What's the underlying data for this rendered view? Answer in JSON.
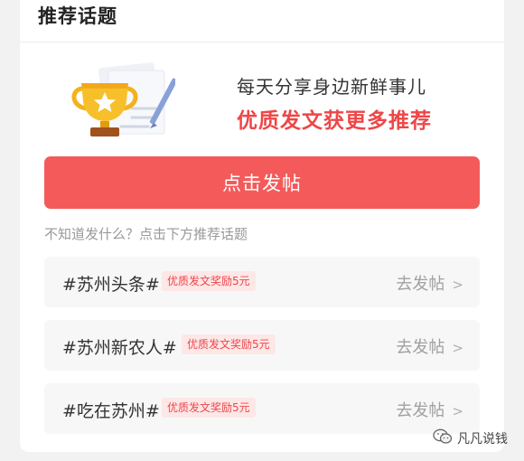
{
  "header": {
    "title": "推荐话题"
  },
  "promo": {
    "line1": "每天分享身边新鲜事儿",
    "line2": "优质发文获更多推荐",
    "illustration_icon": "trophy-with-document-and-pen"
  },
  "post_button": {
    "label": "点击发帖"
  },
  "hint": "不知道发什么？点击下方推荐话题",
  "topics": [
    {
      "name": "#苏州头条#",
      "badge": "优质发文奖励5元",
      "action": "去发帖"
    },
    {
      "name": "#苏州新农人#",
      "badge": "优质发文奖励5元",
      "action": "去发帖"
    },
    {
      "name": "#吃在苏州#",
      "badge": "优质发文奖励5元",
      "action": "去发帖"
    }
  ],
  "watermark": {
    "label": "凡凡说钱",
    "icon": "wechat-icon"
  },
  "colors": {
    "accent": "#f45a5a",
    "highlight_text": "#ee4648",
    "badge_bg": "#fde7e7",
    "row_bg": "#f7f7f7"
  }
}
